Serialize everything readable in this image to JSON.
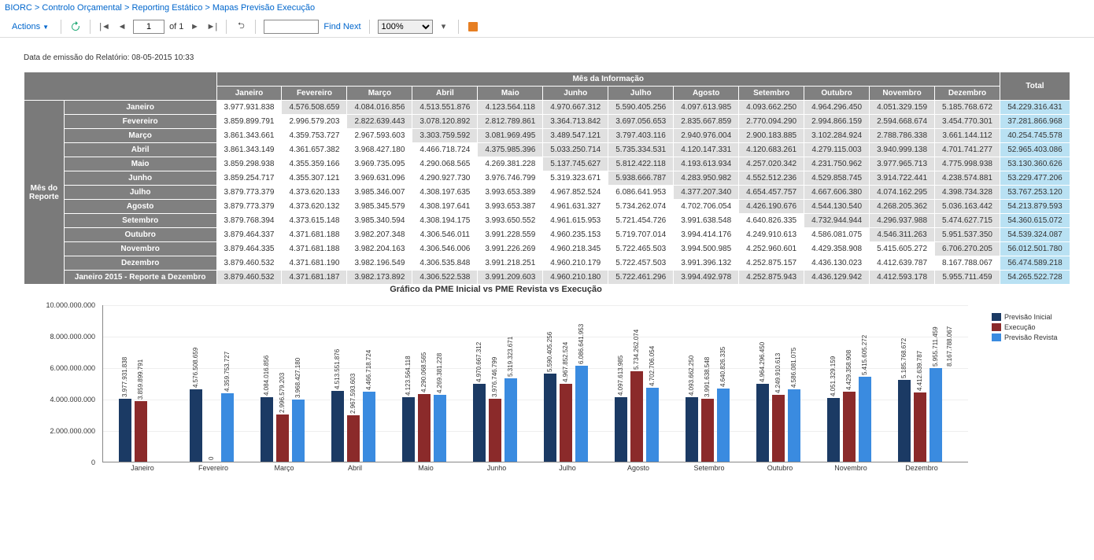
{
  "breadcrumb": {
    "p1": "BIORC",
    "p2": "Controlo Orçamental",
    "p3": "Reporting Estático",
    "p4": "Mapas Previsão Execução"
  },
  "toolbar": {
    "actions": "Actions",
    "page_value": "1",
    "of_label": "of 1",
    "find_next": "Find Next",
    "zoom": "100%"
  },
  "report": {
    "emissao": "Data de emissão do Relatório: 08-05-2015 10:33",
    "col_header": "Mês da Informação",
    "row_header": "Mês do Reporte",
    "months": [
      "Janeiro",
      "Fevereiro",
      "Março",
      "Abril",
      "Maio",
      "Junho",
      "Julho",
      "Agosto",
      "Setembro",
      "Outubro",
      "Novembro",
      "Dezembro"
    ],
    "total_label": "Total",
    "rows": [
      {
        "label": "Janeiro",
        "cells": [
          "3.977.931.838",
          "4.576.508.659",
          "4.084.016.856",
          "4.513.551.876",
          "4.123.564.118",
          "4.970.667.312",
          "5.590.405.256",
          "4.097.613.985",
          "4.093.662.250",
          "4.964.296.450",
          "4.051.329.159",
          "5.185.768.672"
        ],
        "total": "54.229.316.431",
        "diag": 0
      },
      {
        "label": "Fevereiro",
        "cells": [
          "3.859.899.791",
          "2.996.579.203",
          "2.822.639.443",
          "3.078.120.892",
          "2.812.789.861",
          "3.364.713.842",
          "3.697.056.653",
          "2.835.667.859",
          "2.770.094.290",
          "2.994.866.159",
          "2.594.668.674",
          "3.454.770.301"
        ],
        "total": "37.281.866.968",
        "diag": 1
      },
      {
        "label": "Março",
        "cells": [
          "3.861.343.661",
          "4.359.753.727",
          "2.967.593.603",
          "3.303.759.592",
          "3.081.969.495",
          "3.489.547.121",
          "3.797.403.116",
          "2.940.976.004",
          "2.900.183.885",
          "3.102.284.924",
          "2.788.786.338",
          "3.661.144.112"
        ],
        "total": "40.254.745.578",
        "diag": 2
      },
      {
        "label": "Abril",
        "cells": [
          "3.861.343.149",
          "4.361.657.382",
          "3.968.427.180",
          "4.466.718.724",
          "4.375.985.396",
          "5.033.250.714",
          "5.735.334.531",
          "4.120.147.331",
          "4.120.683.261",
          "4.279.115.003",
          "3.940.999.138",
          "4.701.741.277"
        ],
        "total": "52.965.403.086",
        "diag": 3
      },
      {
        "label": "Maio",
        "cells": [
          "3.859.298.938",
          "4.355.359.166",
          "3.969.735.095",
          "4.290.068.565",
          "4.269.381.228",
          "5.137.745.627",
          "5.812.422.118",
          "4.193.613.934",
          "4.257.020.342",
          "4.231.750.962",
          "3.977.965.713",
          "4.775.998.938"
        ],
        "total": "53.130.360.626",
        "diag": 4
      },
      {
        "label": "Junho",
        "cells": [
          "3.859.254.717",
          "4.355.307.121",
          "3.969.631.096",
          "4.290.927.730",
          "3.976.746.799",
          "5.319.323.671",
          "5.938.666.787",
          "4.283.950.982",
          "4.552.512.236",
          "4.529.858.745",
          "3.914.722.441",
          "4.238.574.881"
        ],
        "total": "53.229.477.206",
        "diag": 5
      },
      {
        "label": "Julho",
        "cells": [
          "3.879.773.379",
          "4.373.620.133",
          "3.985.346.007",
          "4.308.197.635",
          "3.993.653.389",
          "4.967.852.524",
          "6.086.641.953",
          "4.377.207.340",
          "4.654.457.757",
          "4.667.606.380",
          "4.074.162.295",
          "4.398.734.328"
        ],
        "total": "53.767.253.120",
        "diag": 6
      },
      {
        "label": "Agosto",
        "cells": [
          "3.879.773.379",
          "4.373.620.132",
          "3.985.345.579",
          "4.308.197.641",
          "3.993.653.387",
          "4.961.631.327",
          "5.734.262.074",
          "4.702.706.054",
          "4.426.190.676",
          "4.544.130.540",
          "4.268.205.362",
          "5.036.163.442"
        ],
        "total": "54.213.879.593",
        "diag": 7
      },
      {
        "label": "Setembro",
        "cells": [
          "3.879.768.394",
          "4.373.615.148",
          "3.985.340.594",
          "4.308.194.175",
          "3.993.650.552",
          "4.961.615.953",
          "5.721.454.726",
          "3.991.638.548",
          "4.640.826.335",
          "4.732.944.944",
          "4.296.937.988",
          "5.474.627.715"
        ],
        "total": "54.360.615.072",
        "diag": 8
      },
      {
        "label": "Outubro",
        "cells": [
          "3.879.464.337",
          "4.371.681.188",
          "3.982.207.348",
          "4.306.546.011",
          "3.991.228.559",
          "4.960.235.153",
          "5.719.707.014",
          "3.994.414.176",
          "4.249.910.613",
          "4.586.081.075",
          "4.546.311.263",
          "5.951.537.350"
        ],
        "total": "54.539.324.087",
        "diag": 9
      },
      {
        "label": "Novembro",
        "cells": [
          "3.879.464.335",
          "4.371.681.188",
          "3.982.204.163",
          "4.306.546.006",
          "3.991.226.269",
          "4.960.218.345",
          "5.722.465.503",
          "3.994.500.985",
          "4.252.960.601",
          "4.429.358.908",
          "5.415.605.272",
          "6.706.270.205"
        ],
        "total": "56.012.501.780",
        "diag": 10
      },
      {
        "label": "Dezembro",
        "cells": [
          "3.879.460.532",
          "4.371.681.190",
          "3.982.196.549",
          "4.306.535.848",
          "3.991.218.251",
          "4.960.210.179",
          "5.722.457.503",
          "3.991.396.132",
          "4.252.875.157",
          "4.436.130.023",
          "4.412.639.787",
          "8.167.788.067"
        ],
        "total": "56.474.589.218",
        "diag": 11
      },
      {
        "label": "Janeiro 2015 - Reporte a Dezembro",
        "cells": [
          "3.879.460.532",
          "4.371.681.187",
          "3.982.173.892",
          "4.306.522.538",
          "3.991.209.603",
          "4.960.210.180",
          "5.722.461.296",
          "3.994.492.978",
          "4.252.875.943",
          "4.436.129.942",
          "4.412.593.178",
          "5.955.711.459"
        ],
        "total": "54.265.522.728",
        "diag": -1
      }
    ]
  },
  "chart_data": {
    "title": "Gráfico da PME Inicial vs PME Revista vs Execução",
    "type": "bar",
    "ylim": [
      0,
      10000000000
    ],
    "ylabels": [
      "0",
      "2.000.000.000",
      "4.000.000.000",
      "6.000.000.000",
      "8.000.000.000",
      "10.000.000.000"
    ],
    "categories": [
      "Janeiro",
      "Fevereiro",
      "Março",
      "Abril",
      "Maio",
      "Junho",
      "Julho",
      "Agosto",
      "Setembro",
      "Outubro",
      "Novembro",
      "Dezembro"
    ],
    "series": [
      {
        "name": "Previsão Inicial",
        "color": "#1b3a64",
        "values": [
          3977931838,
          4576508659,
          4084016856,
          4513551876,
          4123564118,
          4970667312,
          5590405256,
          4097613985,
          4093662250,
          4964296450,
          4051329159,
          5185768672
        ],
        "labels": [
          "3.977.931.838",
          "4.576.508.659",
          "4.084.016.856",
          "4.513.551.876",
          "4.123.564.118",
          "4.970.667.312",
          "5.590.405.256",
          "4.097.613.985",
          "4.093.662.250",
          "4.964.296.450",
          "4.051.329.159",
          "5.185.768.672"
        ]
      },
      {
        "name": "Execução",
        "color": "#8b2a2a",
        "values": [
          3859899791,
          0,
          2996579203,
          2967593603,
          4290068565,
          3976746799,
          4967852524,
          5734262074,
          3991638548,
          4249910613,
          4429358908,
          4412639787
        ],
        "labels": [
          "3.859.899.791",
          "0",
          "2.996.579.203",
          "2.967.593.603",
          "4.290.068.565",
          "3.976.746.799",
          "4.967.852.524",
          "5.734.262.074",
          "3.991.638.548",
          "4.249.910.613",
          "4.429.358.908",
          "4.412.639.787"
        ]
      },
      {
        "name": "Previsão Revista",
        "color": "#3a8be0",
        "values": [
          null,
          4359753727,
          3968427180,
          4466718724,
          4269381228,
          5319323671,
          6086641953,
          4702706054,
          4640826335,
          4586081075,
          5415605272,
          5955711459
        ],
        "labels": [
          null,
          "4.359.753.727",
          "3.968.427.180",
          "4.466.718.724",
          "4.269.381.228",
          "5.319.323.671",
          "6.086.641.953",
          "4.702.706.054",
          "4.640.826.335",
          "4.586.081.075",
          "5.415.605.272",
          "5.955.711.459"
        ],
        "extra_labels": [
          null,
          null,
          null,
          null,
          null,
          null,
          null,
          null,
          null,
          null,
          null,
          "8.167.788.067"
        ]
      }
    ]
  }
}
